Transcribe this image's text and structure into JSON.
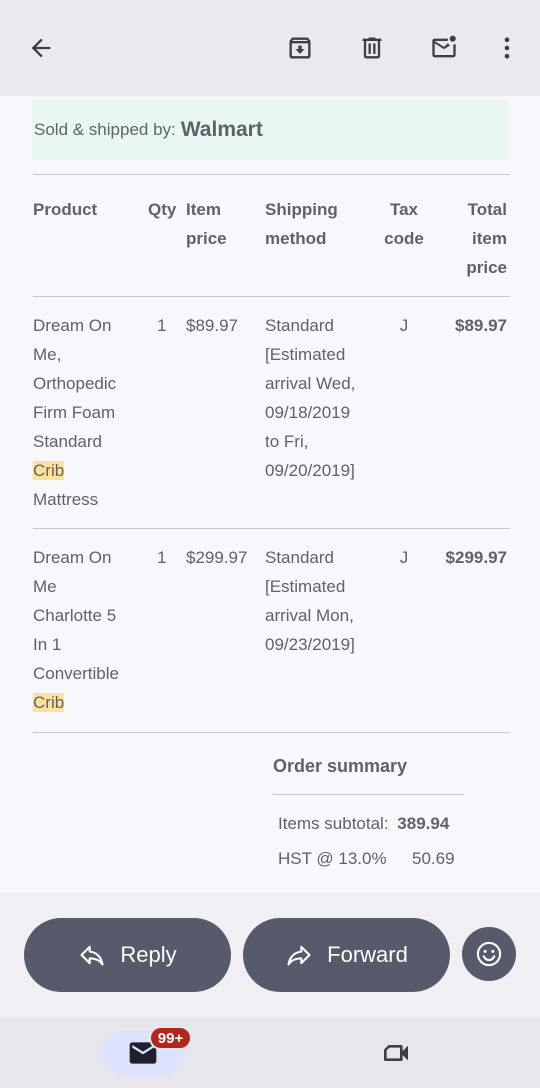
{
  "sold": {
    "label": "Sold & shipped by:",
    "seller": "Walmart"
  },
  "table": {
    "headers": {
      "product": "Product",
      "qty": "Qty",
      "item_price": [
        "Item",
        "price"
      ],
      "shipping": [
        "Shipping",
        "method"
      ],
      "tax": [
        "Tax",
        "code"
      ],
      "total": [
        "Total",
        "item",
        "price"
      ]
    },
    "rows": [
      {
        "product_lines": [
          "Dream On",
          "Me,",
          "Orthopedic",
          "Firm Foam",
          "Standard"
        ],
        "product_highlight": "Crib",
        "product_tail": "Mattress",
        "qty": "1",
        "item_price": "$89.97",
        "shipping_lines": [
          "Standard",
          "[Estimated",
          "arrival Wed,",
          "09/18/2019",
          "to Fri,",
          "09/20/2019]"
        ],
        "tax": "J",
        "total": "$89.97"
      },
      {
        "product_lines": [
          "Dream On",
          "Me",
          "Charlotte 5",
          "In 1",
          "Convertible"
        ],
        "product_highlight": "Crib",
        "qty": "1",
        "item_price": "$299.97",
        "shipping_lines": [
          "Standard",
          "[Estimated",
          "arrival Mon,",
          "09/23/2019]"
        ],
        "tax": "J",
        "total": "$299.97"
      }
    ]
  },
  "summary": {
    "title": "Order summary",
    "subtotal_label": "Items subtotal:",
    "subtotal_value": "389.94",
    "hst_label": "HST @ 13.0%",
    "hst_value": "50.69"
  },
  "actions": {
    "reply": "Reply",
    "forward": "Forward"
  },
  "nav": {
    "mail_badge": "99+"
  },
  "icons": {
    "back": "arrow-back-icon",
    "archive": "archive-icon",
    "delete": "trash-icon",
    "unread": "mark-unread-icon",
    "more": "more-vert-icon",
    "reply": "reply-icon",
    "forward": "forward-icon",
    "emoji": "emoji-icon",
    "mail": "mail-icon",
    "video": "video-icon"
  },
  "colors": {
    "highlight": "#fde29b",
    "accent_pill": "#565a6b",
    "badge": "#b3261e",
    "sold_bg": "#e8f6f4"
  }
}
